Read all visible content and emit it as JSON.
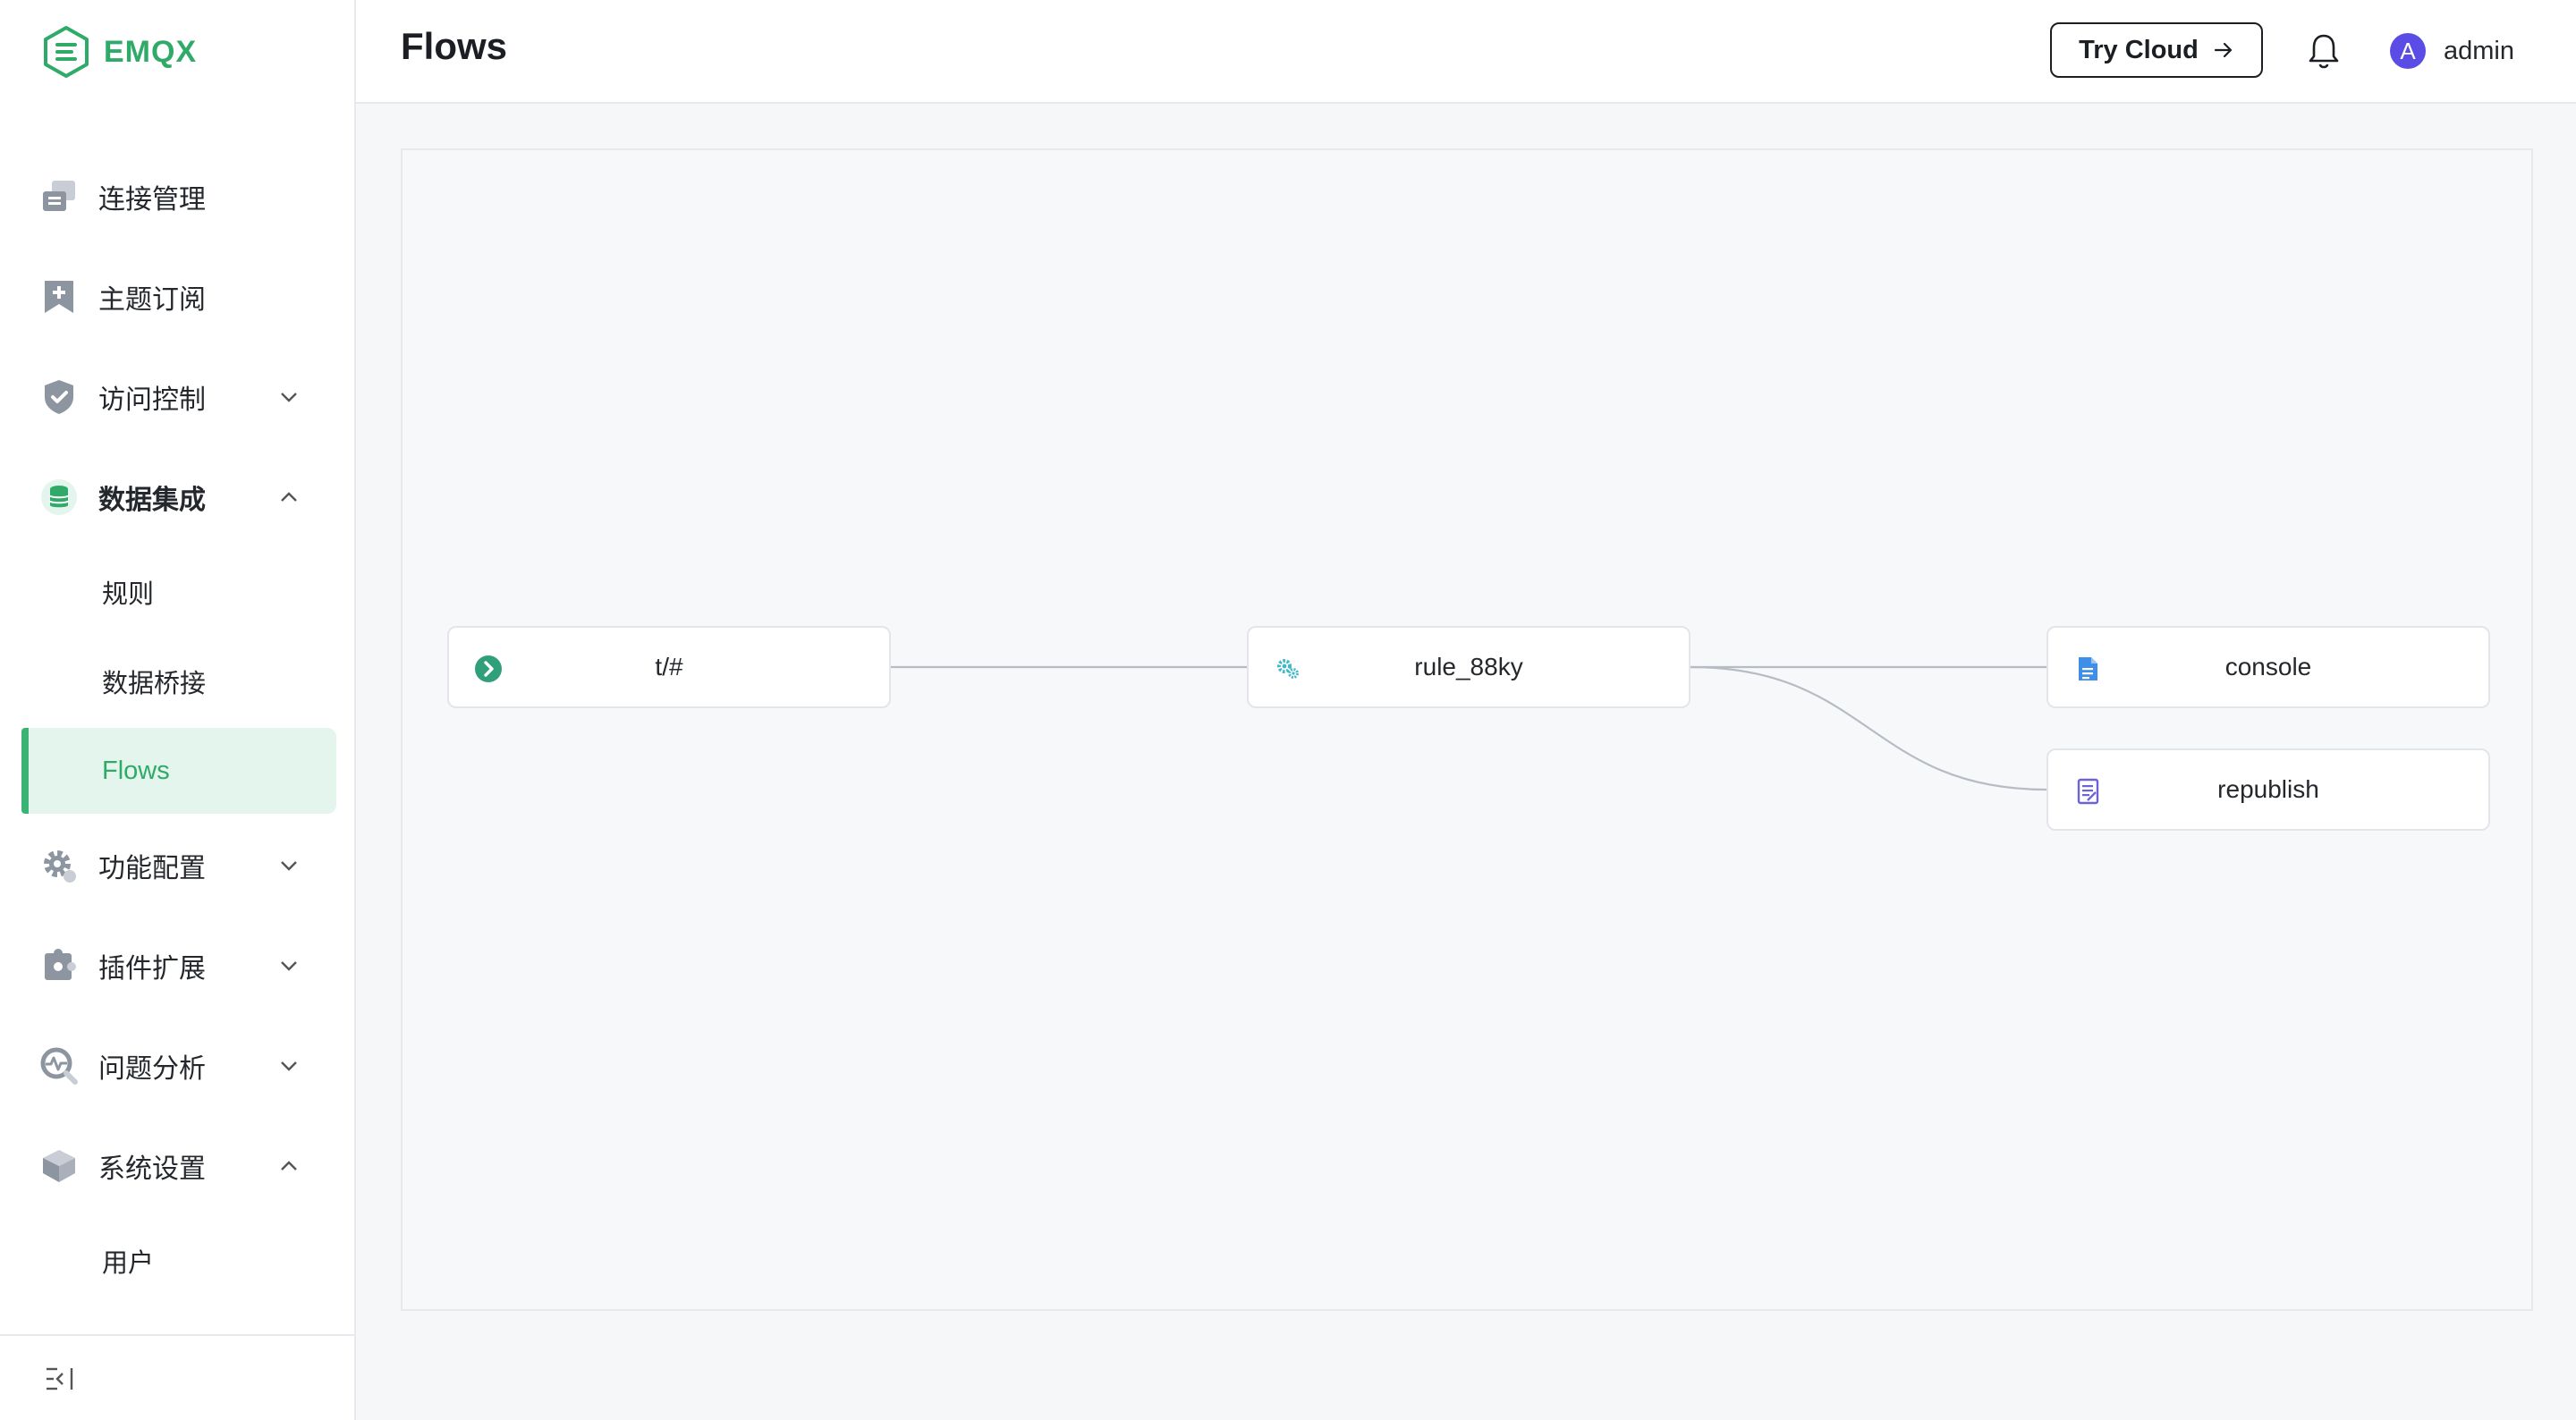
{
  "brand": {
    "name": "EMQX",
    "icon": "emqx-logo-icon",
    "color": "#2faa69"
  },
  "sidebar": {
    "items": [
      {
        "label": "连接管理",
        "icon": "connections-icon"
      },
      {
        "label": "主题订阅",
        "icon": "bookmark-plus-icon"
      },
      {
        "label": "访问控制",
        "icon": "shield-check-icon",
        "expanded": false
      },
      {
        "label": "数据集成",
        "icon": "database-icon",
        "expanded": true,
        "children": [
          {
            "label": "规则"
          },
          {
            "label": "数据桥接"
          },
          {
            "label": "Flows",
            "active": true
          }
        ]
      },
      {
        "label": "功能配置",
        "icon": "gear-icon",
        "expanded": false
      },
      {
        "label": "插件扩展",
        "icon": "puzzle-icon",
        "expanded": false
      },
      {
        "label": "问题分析",
        "icon": "pulse-search-icon",
        "expanded": false
      },
      {
        "label": "系统设置",
        "icon": "layers-icon",
        "expanded": true,
        "children": [
          {
            "label": "用户"
          }
        ]
      }
    ],
    "collapse_icon": "collapse-sidebar-icon"
  },
  "header": {
    "title": "Flows",
    "try_cloud_label": "Try Cloud",
    "bell_icon": "bell-icon",
    "avatar_letter": "A",
    "username": "admin",
    "avatar_color": "#5b4ce6"
  },
  "flow": {
    "nodes": [
      {
        "id": "source",
        "label": "t/#",
        "icon": "chevron-circle-icon",
        "kind": "topic"
      },
      {
        "id": "rule",
        "label": "rule_88ky",
        "icon": "gears-icon",
        "kind": "rule"
      },
      {
        "id": "console",
        "label": "console",
        "icon": "file-icon",
        "kind": "action"
      },
      {
        "id": "republish",
        "label": "republish",
        "icon": "document-edit-icon",
        "kind": "action"
      }
    ],
    "edges": [
      {
        "from": "source",
        "to": "rule"
      },
      {
        "from": "rule",
        "to": "console"
      },
      {
        "from": "rule",
        "to": "republish"
      }
    ]
  }
}
